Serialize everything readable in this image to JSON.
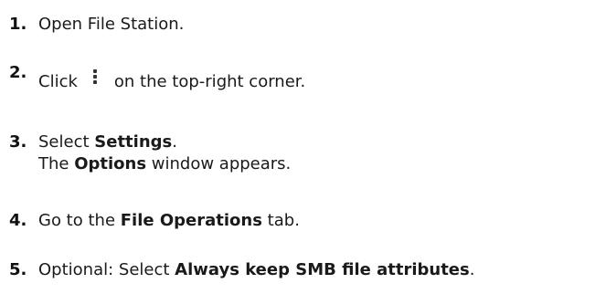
{
  "steps": [
    {
      "number": "1.",
      "text": "Open File Station."
    },
    {
      "number": "2.",
      "before_icon": "Click",
      "icon": "more-vertical-icon",
      "after_icon": "on the top-right corner."
    },
    {
      "number": "3.",
      "prefix": "Select ",
      "bold": "Settings",
      "suffix": ".",
      "line2_bold": "Options",
      "line2_suffix": " window appears.",
      "line2_prefix": "The "
    },
    {
      "number": "4.",
      "prefix": "Go to the ",
      "bold": "File Operations",
      "suffix": " tab."
    },
    {
      "number": "5.",
      "prefix": "Optional: Select ",
      "bold": "Always keep SMB file attributes",
      "suffix": "."
    }
  ]
}
